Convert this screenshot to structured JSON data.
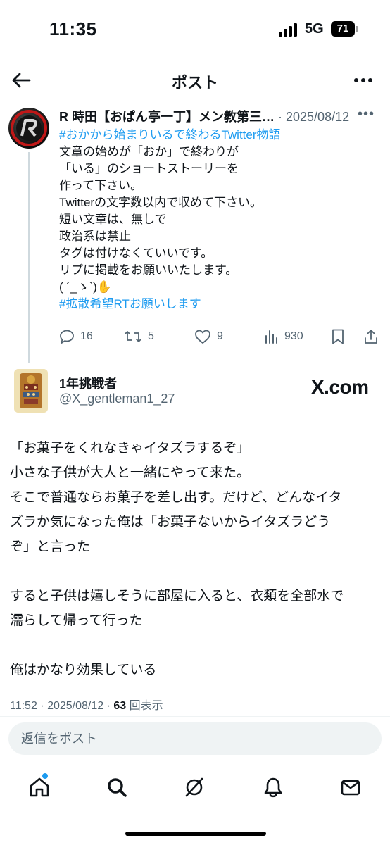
{
  "status_bar": {
    "time": "11:35",
    "network": "5G",
    "battery": "71"
  },
  "header": {
    "title": "ポスト"
  },
  "original_post": {
    "author_name": "R 時田【おぱん亭一丁】メン教第三…",
    "date": "· 2025/08/12",
    "lines": [
      {
        "text": "#おかから始まりいるで終わるTwitter物語",
        "hashtag": true
      },
      {
        "text": "文章の始めが「おか」で終わりが",
        "hashtag": false
      },
      {
        "text": "「いる」のショートストーリーを",
        "hashtag": false
      },
      {
        "text": "作って下さい。",
        "hashtag": false
      },
      {
        "text": "Twitterの文字数以内で収めて下さい。",
        "hashtag": false
      },
      {
        "text": "短い文章は、無しで",
        "hashtag": false
      },
      {
        "text": "政治系は禁止",
        "hashtag": false
      },
      {
        "text": "タグは付けなくていいです。",
        "hashtag": false
      },
      {
        "text": "リプに掲載をお願いいたします。",
        "hashtag": false
      },
      {
        "text": "( ´_ゝ`)✋",
        "hashtag": false
      },
      {
        "text": "#拡散希望RTお願いします",
        "hashtag": true
      }
    ],
    "stats": {
      "replies": "16",
      "reposts": "5",
      "likes": "9",
      "views": "930"
    }
  },
  "reply_post": {
    "author_name": "1年挑戦者",
    "handle": "@X_gentleman1_27",
    "badge": "X.com",
    "lines": [
      "「お菓子をくれなきゃイタズラするぞ」",
      "小さな子供が大人と一緒にやって来た。",
      "そこで普通ならお菓子を差し出す。だけど、どんなイタ",
      "ズラか気になった俺は「お菓子ないからイタズラどう",
      "ぞ」と言った",
      "",
      "すると子供は嬉しそうに部屋に入ると、衣類を全部水で",
      "濡らして帰って行った",
      "",
      "俺はかなり効果している"
    ],
    "meta_time": "11:52 · 2025/08/12 · ",
    "meta_views_count": "63",
    "meta_views_label": " 回表示"
  },
  "reply_box": {
    "placeholder": "返信をポスト"
  },
  "tabs": [
    "home-icon",
    "search-icon",
    "grok-icon",
    "notifications-icon",
    "messages-icon"
  ],
  "colors": {
    "accent": "#1d9bf0",
    "text": "#0f1419",
    "muted": "#536471",
    "input_bg": "#eff3f4"
  }
}
